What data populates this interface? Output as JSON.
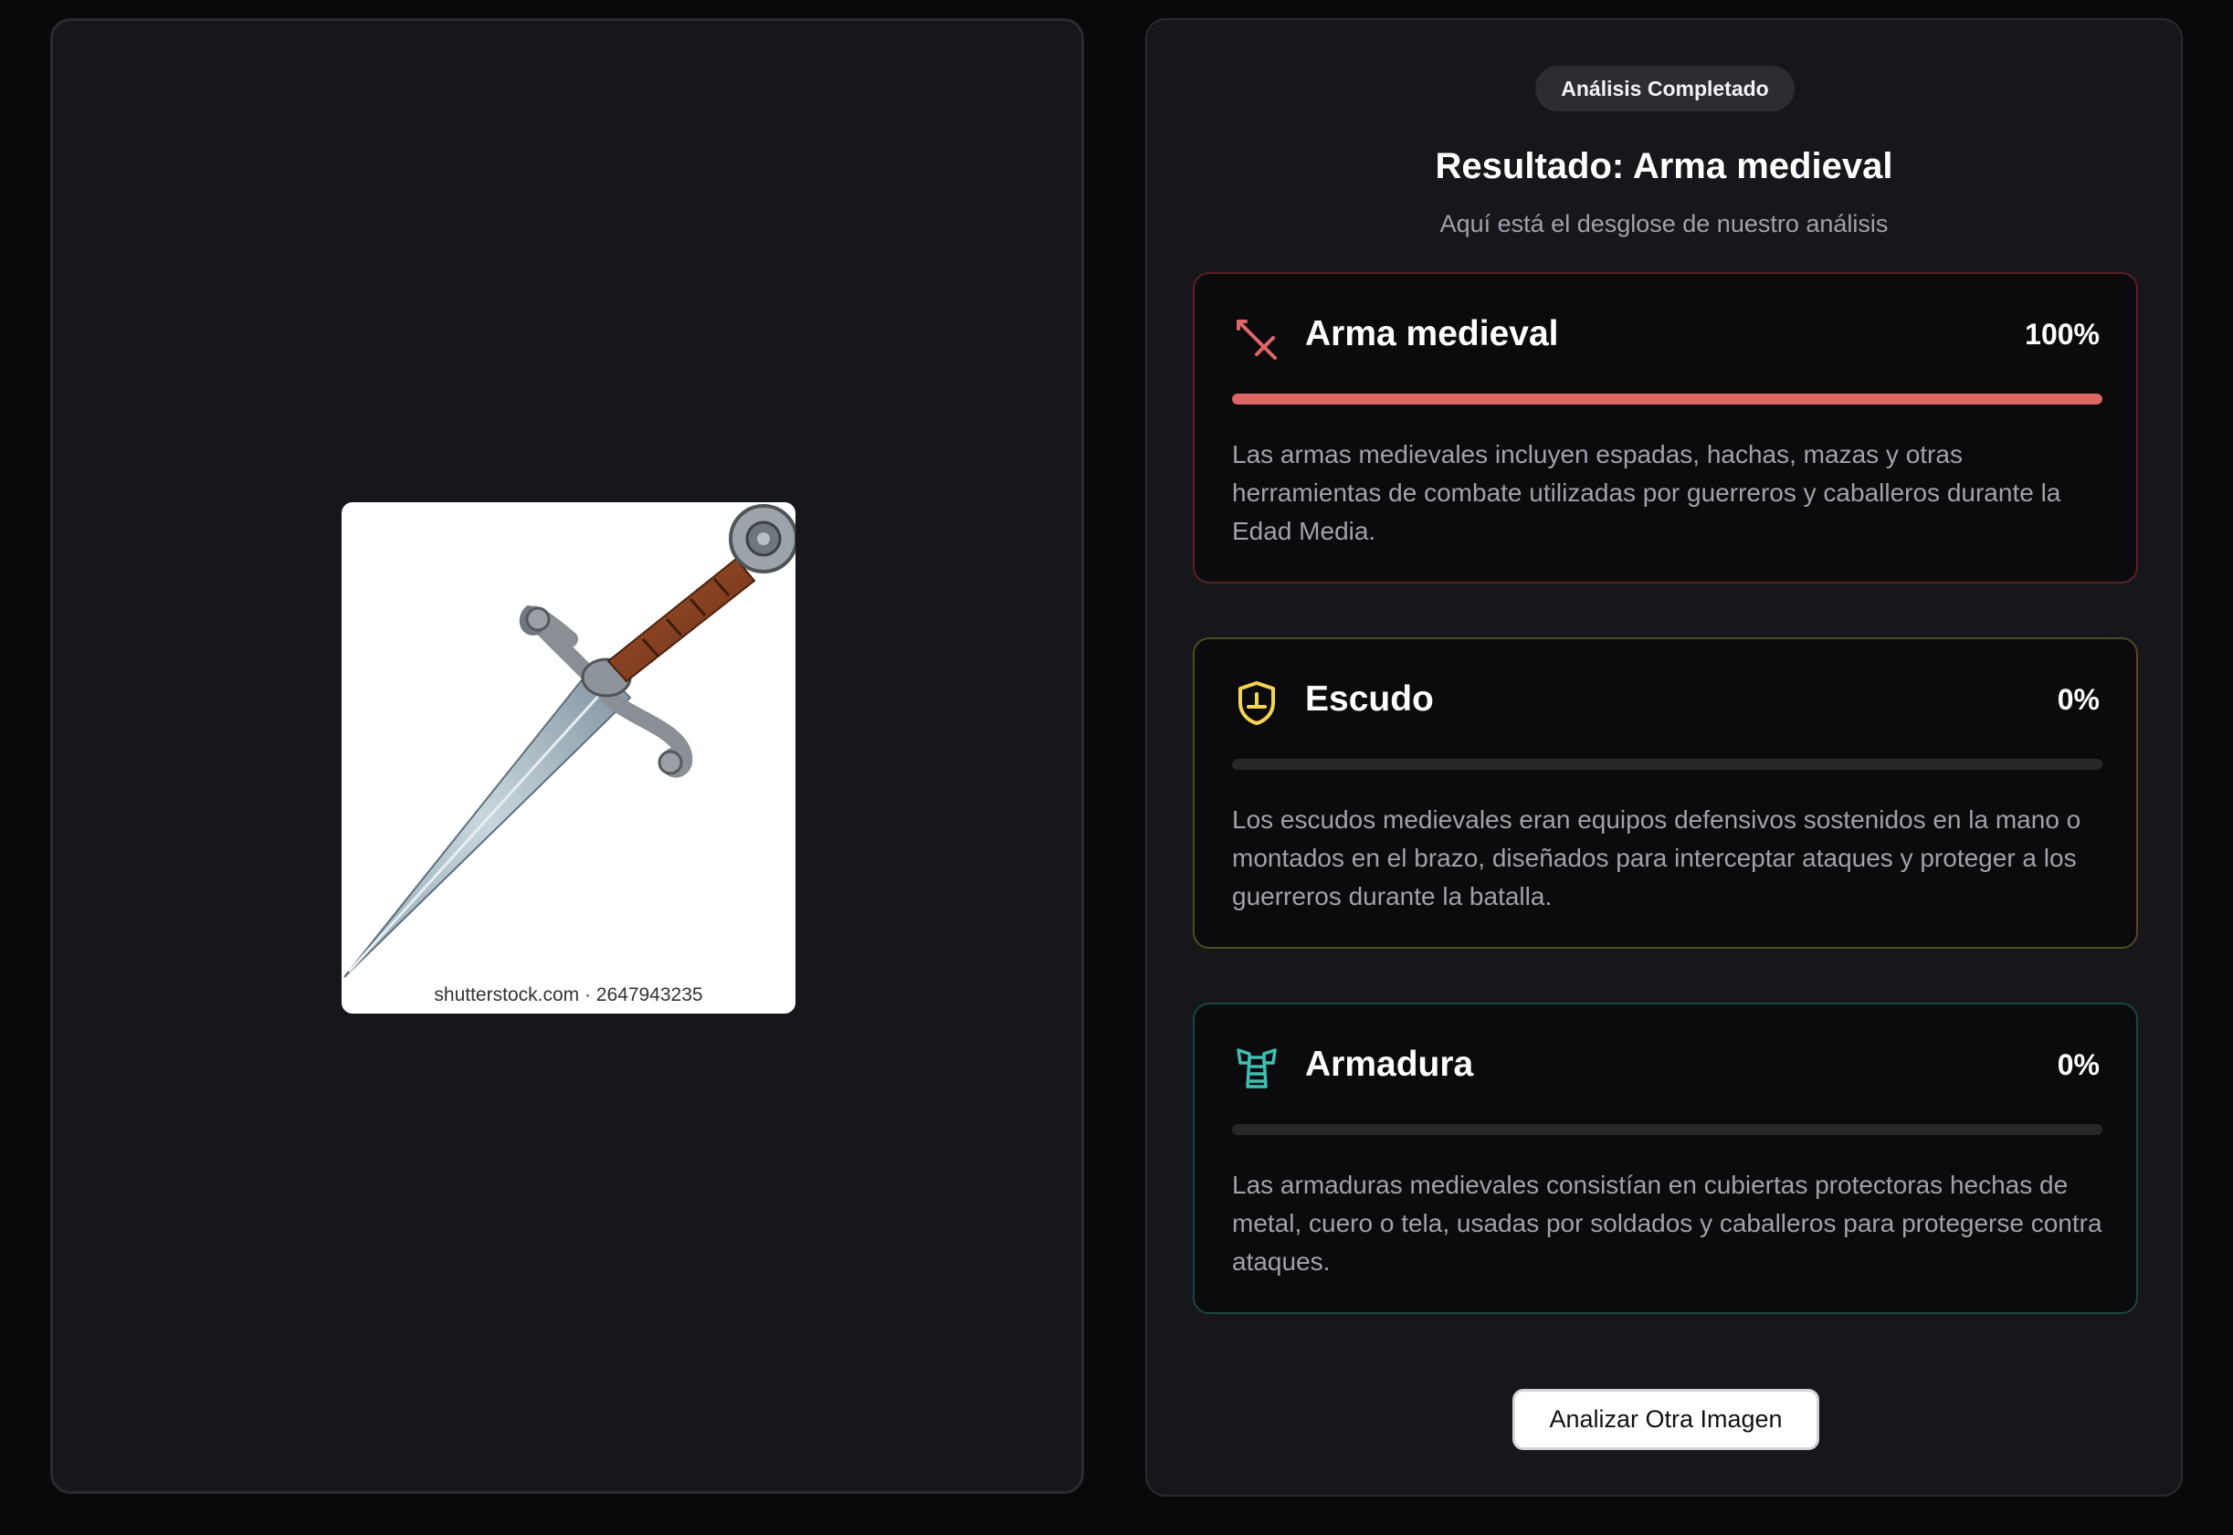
{
  "preview": {
    "watermark": "shutterstock.com · 2647943235"
  },
  "results": {
    "badge": "Análisis Completado",
    "title": "Resultado: Arma medieval",
    "subtitle": "Aquí está el desglose de nuestro análisis",
    "categories": [
      {
        "name": "Arma medieval",
        "percent_label": "100%",
        "percent": 100,
        "icon": "sword-icon",
        "color": "#e06666",
        "border": "#5c2126",
        "description": "Las armas medievales incluyen espadas, hachas, mazas y otras herramientas de combate utilizadas por guerreros y caballeros durante la Edad Media."
      },
      {
        "name": "Escudo",
        "percent_label": "0%",
        "percent": 0,
        "icon": "shield-icon",
        "color": "#f5d453",
        "border": "#4e4a22",
        "description": "Los escudos medievales eran equipos defensivos sostenidos en la mano o montados en el brazo, diseñados para interceptar ataques y proteger a los guerreros durante la batalla."
      },
      {
        "name": "Armadura",
        "percent_label": "0%",
        "percent": 0,
        "icon": "armor-icon",
        "color": "#3fbfb0",
        "border": "#1b4544",
        "description": "Las armaduras medievales consistían en cubiertas protectoras hechas de metal, cuero o tela, usadas por soldados y caballeros para protegerse contra ataques."
      }
    ],
    "action_label": "Analizar Otra Imagen"
  }
}
